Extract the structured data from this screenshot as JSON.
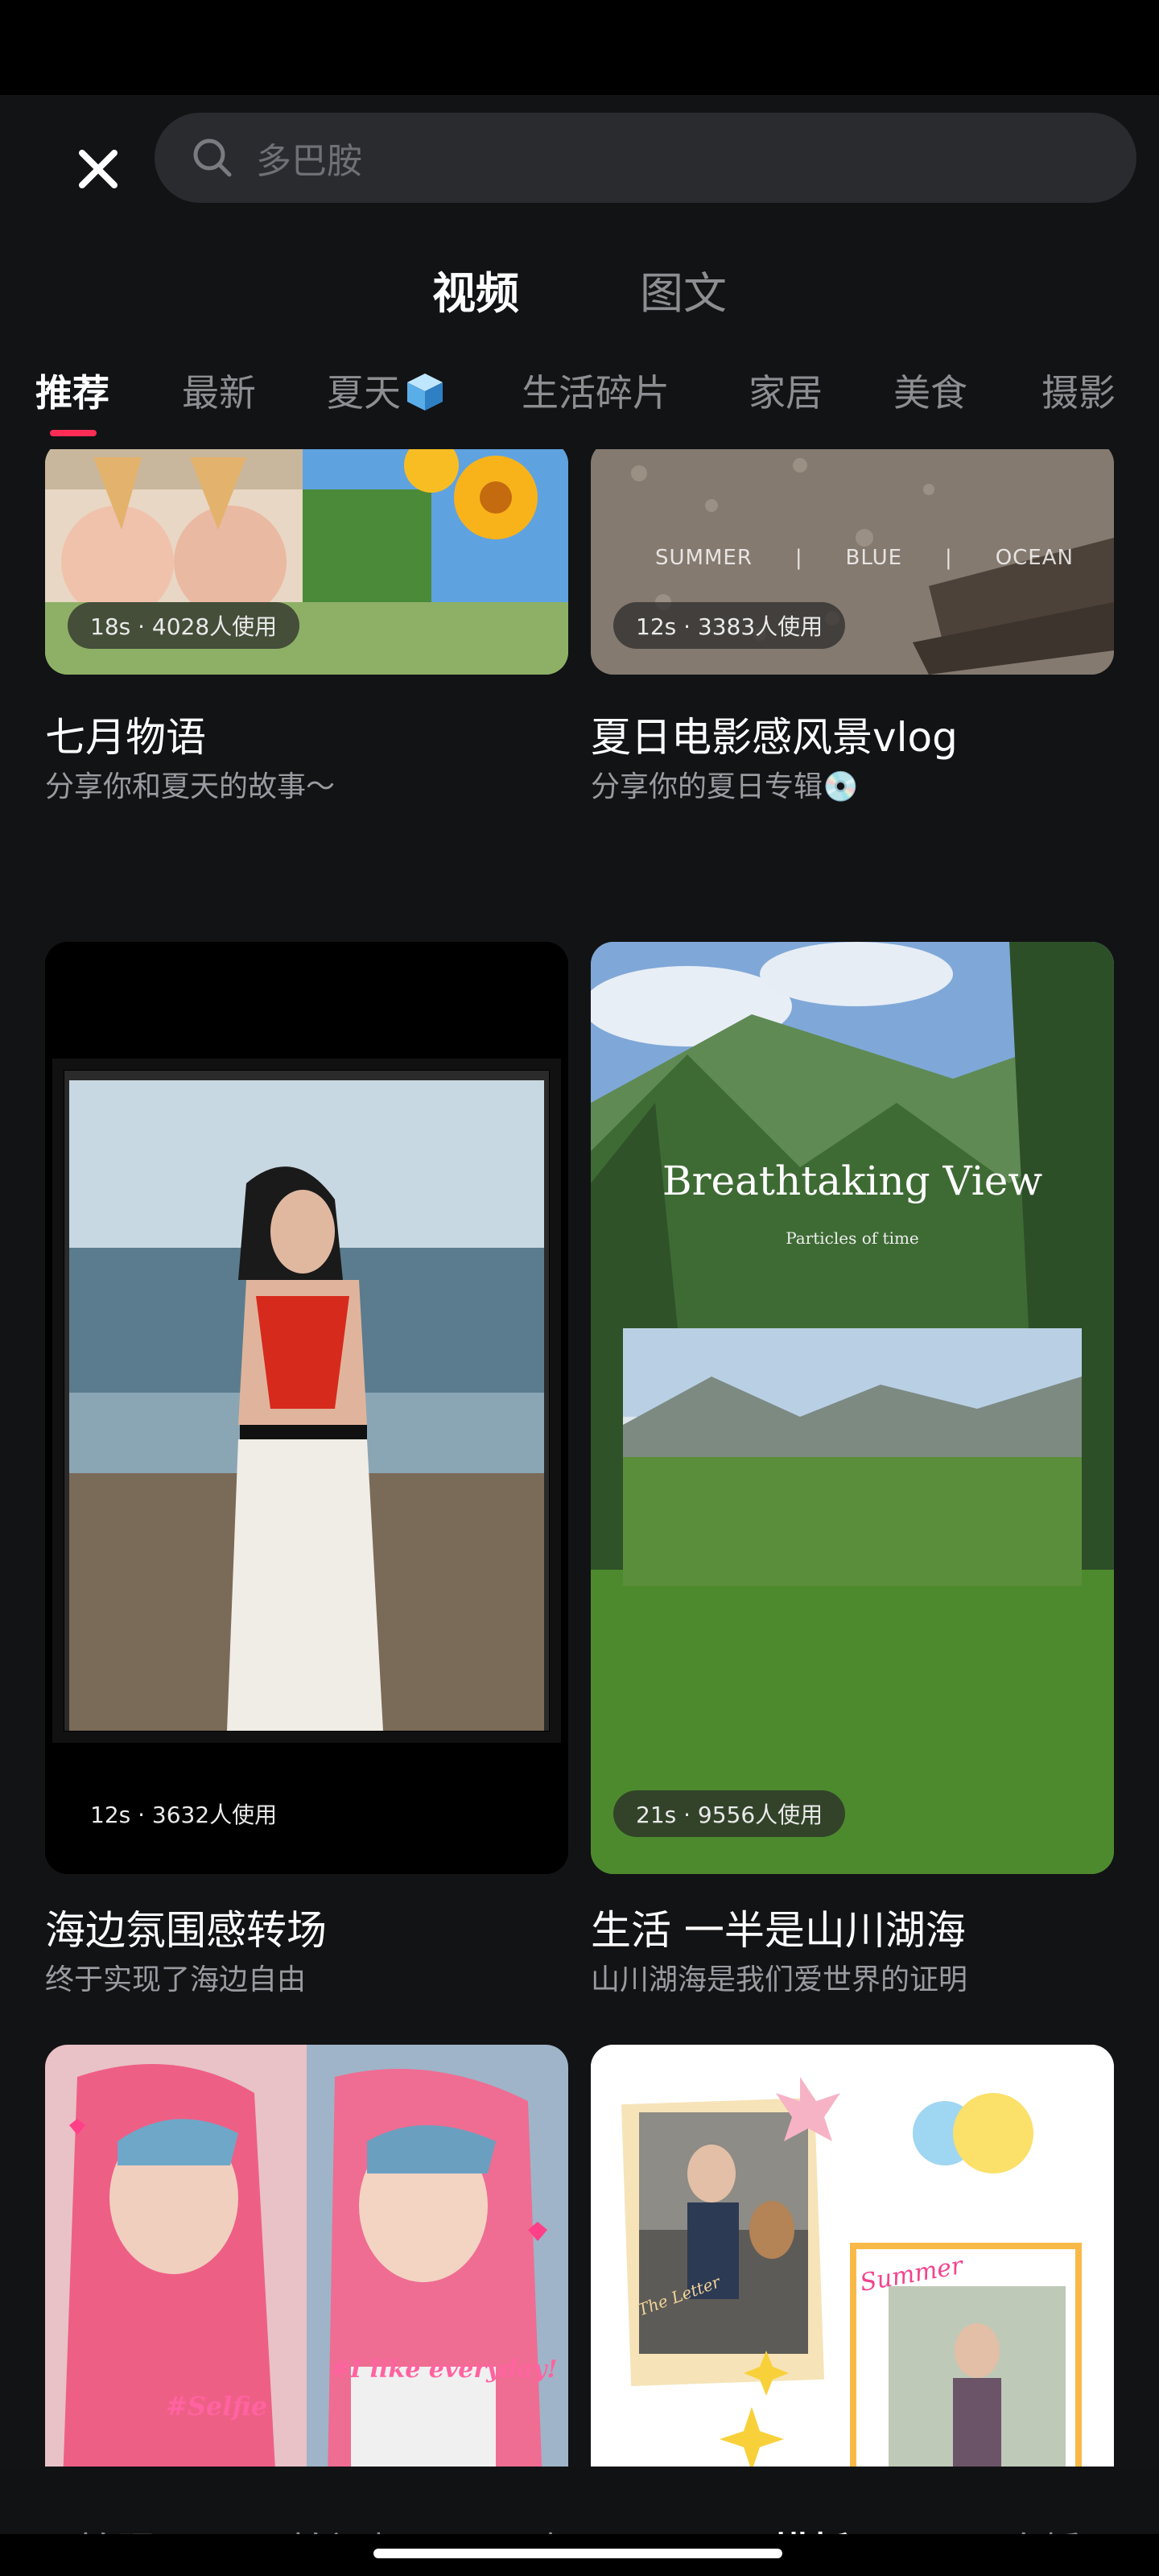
{
  "header": {
    "search_placeholder": "多巴胺",
    "mode_tabs": [
      {
        "label": "视频",
        "active": true
      },
      {
        "label": "图文",
        "active": false
      }
    ]
  },
  "categories": [
    {
      "label": "推荐",
      "active": true
    },
    {
      "label": "最新",
      "active": false
    },
    {
      "label": "夏天",
      "icon": "cube-emoji-icon",
      "active": false
    },
    {
      "label": "生活碎片",
      "active": false
    },
    {
      "label": "家居",
      "active": false
    },
    {
      "label": "美食",
      "active": false
    },
    {
      "label": "摄影",
      "active": false
    }
  ],
  "templates": [
    {
      "badge": "18s · 4028人使用",
      "title": "七月物语",
      "subtitle": "分享你和夏天的故事～"
    },
    {
      "badge": "12s · 3383人使用",
      "title": "夏日电影感风景vlog",
      "subtitle": "分享你的夏日专辑💿",
      "overlay_words": [
        "SUMMER",
        "|",
        "BLUE",
        "|",
        "OCEAN"
      ]
    },
    {
      "badge": "12s · 3632人使用",
      "title": "海边氛围感转场",
      "subtitle": "终于实现了海边自由"
    },
    {
      "badge": "21s · 9556人使用",
      "title": "生活 一半是山川湖海",
      "subtitle": "山川湖海是我们爱世界的证明",
      "overlay_title": "Breathtaking View",
      "overlay_subtitle": "Particles of time"
    },
    {
      "overlay_text_1": "#Selfie",
      "overlay_text_2": "#I like everyday!"
    },
    {
      "overlay_text_1": "Summer",
      "overlay_text_2": "The Letter"
    }
  ],
  "bottom_nav": [
    {
      "label": "拍照",
      "active": false
    },
    {
      "label": "拍视频",
      "active": false
    },
    {
      "label": "相册",
      "active": false
    },
    {
      "label": "模板",
      "active": true
    },
    {
      "label": "直播",
      "active": false
    }
  ],
  "colors": {
    "background": "#121315",
    "accent_underline": "#ff2d55",
    "search_bg": "#2a2b2e",
    "muted_text": "#8d8e92"
  }
}
